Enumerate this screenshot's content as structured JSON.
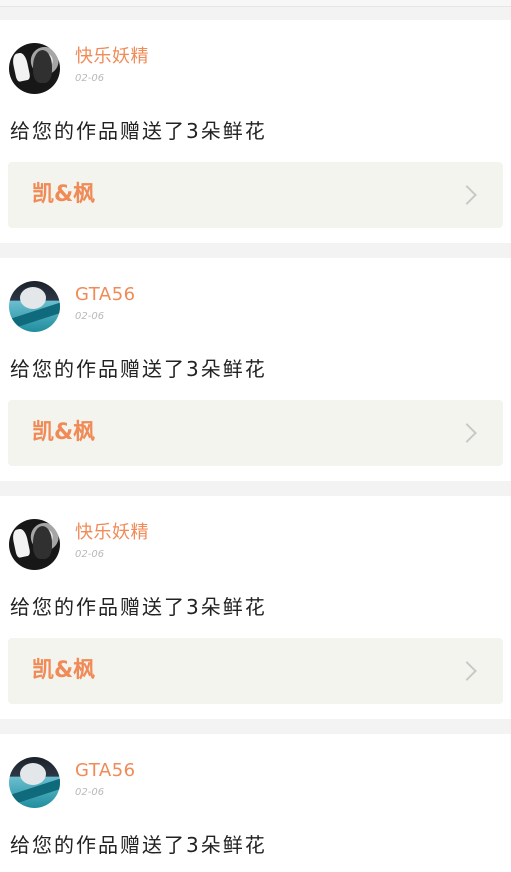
{
  "notifications": [
    {
      "username": "快乐妖精",
      "date": "02-06",
      "message": "给您的作品赠送了3朵鲜花",
      "work_title": "凯&枫",
      "avatar_style": "dark"
    },
    {
      "username": "GTA56",
      "date": "02-06",
      "message": "给您的作品赠送了3朵鲜花",
      "work_title": "凯&枫",
      "avatar_style": "teal"
    },
    {
      "username": "快乐妖精",
      "date": "02-06",
      "message": "给您的作品赠送了3朵鲜花",
      "work_title": "凯&枫",
      "avatar_style": "dark"
    },
    {
      "username": "GTA56",
      "date": "02-06",
      "message": "给您的作品赠送了3朵鲜花",
      "avatar_style": "teal"
    }
  ],
  "colors": {
    "accent": "#f08b58",
    "background": "#f3f3f3",
    "card": "#ffffff",
    "work_row": "#f4f4ee",
    "muted": "#b9b9b9",
    "text": "#222222"
  },
  "icons": {
    "chevron": "chevron-right-icon"
  }
}
